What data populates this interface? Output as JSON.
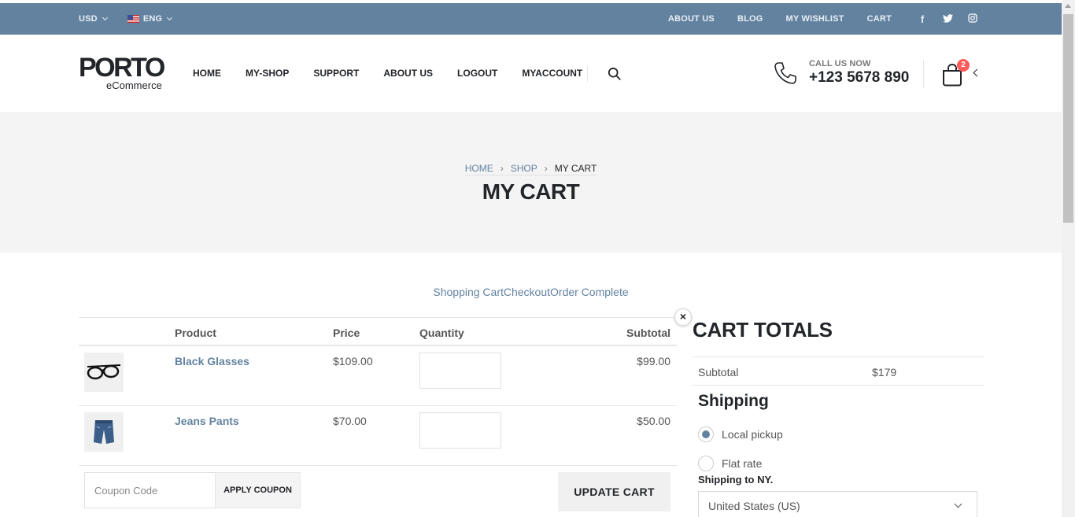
{
  "topbar": {
    "currency": "USD",
    "language": "ENG",
    "links": [
      "ABOUT US",
      "BLOG",
      "MY WISHLIST",
      "CART"
    ],
    "social": [
      "facebook-icon",
      "twitter-icon",
      "instagram-icon"
    ],
    "background": "#6282a0"
  },
  "header": {
    "logo_word": "PORTO",
    "logo_sub": "eCommerce",
    "nav": [
      "HOME",
      "MY-SHOP",
      "SUPPORT",
      "ABOUT US",
      "LOGOUT",
      "MYACCOUNT"
    ],
    "call_label": "CALL US NOW",
    "phone": "+123 5678 890",
    "cart_count": "2"
  },
  "page": {
    "breadcrumb": [
      "HOME",
      "SHOP",
      "MY CART"
    ],
    "title": "MY CART",
    "steps": "Shopping CartCheckoutOrder Complete"
  },
  "cart": {
    "headers": {
      "product": "Product",
      "price": "Price",
      "quantity": "Quantity",
      "subtotal": "Subtotal"
    },
    "items": [
      {
        "name": "Black Glasses",
        "price": "$109.00",
        "quantity": "",
        "subtotal": "$99.00",
        "icon": "glasses-icon"
      },
      {
        "name": "Jeans Pants",
        "price": "$70.00",
        "quantity": "",
        "subtotal": "$50.00",
        "icon": "jeans-icon"
      }
    ],
    "coupon_placeholder": "Coupon Code",
    "apply_label": "APPLY COUPON",
    "update_label": "UPDATE CART"
  },
  "totals": {
    "title": "CART TOTALS",
    "subtotal_label": "Subtotal",
    "subtotal_value": "$179",
    "shipping_title": "Shipping",
    "options": [
      {
        "label": "Local pickup",
        "selected": true
      },
      {
        "label": "Flat rate",
        "selected": false
      }
    ],
    "ship_to": "Shipping to NY.",
    "country": "United States (US)"
  },
  "colors": {
    "accent": "#6282a0",
    "badge": "#ff5b5b",
    "band": "#f4f4f4"
  }
}
